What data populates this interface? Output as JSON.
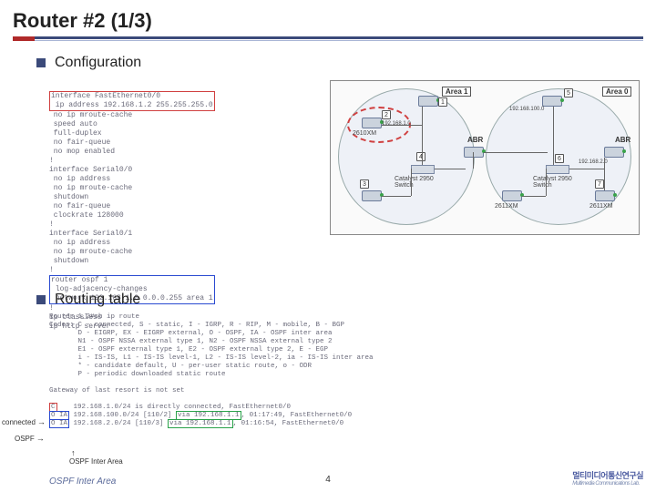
{
  "title": "Router #2 (1/3)",
  "sections": {
    "configuration_label": "Configuration",
    "routing_label": "Routing table"
  },
  "config": {
    "l1": "interface FastEthernet0/0",
    "l2": " ip address 192.168.1.2 255.255.255.0",
    "l3": " no ip mroute-cache",
    "l4": " speed auto",
    "l5": " full-duplex",
    "l6": " no fair-queue",
    "l7": " no mop enabled",
    "l8": "!",
    "l9": "interface Serial0/0",
    "l10": " no ip address",
    "l11": " no ip mroute-cache",
    "l12": " shutdown",
    "l13": " no fair-queue",
    "l14": " clockrate 128000",
    "l15": "!",
    "l16": "interface Serial0/1",
    "l17": " no ip address",
    "l18": " no ip mroute-cache",
    "l19": " shutdown",
    "l20": "!",
    "l21": "router ospf 1",
    "l22": " log-adjacency-changes",
    "l23": " network 192.168.1.0 0.0.0.255 area 1",
    "l24": "!",
    "l25": "ip classless",
    "l26": "ip http server"
  },
  "routing": {
    "l1": "Router_1_2#sh ip route",
    "l2": "Codes: C - connected, S - static, I - IGRP, R - RIP, M - mobile, B - BGP",
    "l3": "       D - EIGRP, EX - EIGRP external, O - OSPF, IA - OSPF inter area",
    "l4": "       N1 - OSPF NSSA external type 1, N2 - OSPF NSSA external type 2",
    "l5": "       E1 - OSPF external type 1, E2 - OSPF external type 2, E - EGP",
    "l6": "       i - IS-IS, L1 - IS-IS level-1, L2 - IS-IS level-2, ia - IS-IS inter area",
    "l7": "       * - candidate default, U - per-user static route, o - ODR",
    "l8": "       P - periodic downloaded static route",
    "l9": "Gateway of last resort is not set",
    "l10_pre": "C",
    "l10_mid": "    192.168.1.0/24 is directly connected, FastEthernet0/0",
    "l11_pre": "O IA",
    "l11_mid": " 192.168.100.0/24 [110/2] ",
    "l11_via": "via 192.168.1.1",
    "l11_post": ", 01:17:49, FastEthernet0/0",
    "l12_pre": "O IA",
    "l12_mid": " 192.168.2.0/24 [110/3] ",
    "l12_via": "via 192.168.1.1",
    "l12_post": ", 01:16:54, FastEthernet0/0"
  },
  "side_labels": {
    "connected": "connected",
    "ospf": "OSPF",
    "ospf_inter": "OSPF Inter Area"
  },
  "topology": {
    "area1_label": "Area 1",
    "area0_label": "Area 0",
    "abr": "ABR",
    "nodes": {
      "n1": "1",
      "n2": "2",
      "n3": "3",
      "n4": "4",
      "n5": "5",
      "n6": "6",
      "n7": "7"
    },
    "dev_2610xm": "2610XM",
    "dev_2611xm_a": "2611XM",
    "dev_2611xm_b": "2611XM",
    "sw": "Catalyst 2950 Switch",
    "sw2": "Catalyst 2950 Switch",
    "ip_a": "192.168.1.0",
    "ip_b": "192.168.100.0",
    "ip_c": "192.168.2.0"
  },
  "footer": {
    "left": "OSPF Inter Area",
    "page": "4",
    "lab": "멀티미디어통신연구실",
    "lab_sub": "Multimedia Communications Lab."
  }
}
